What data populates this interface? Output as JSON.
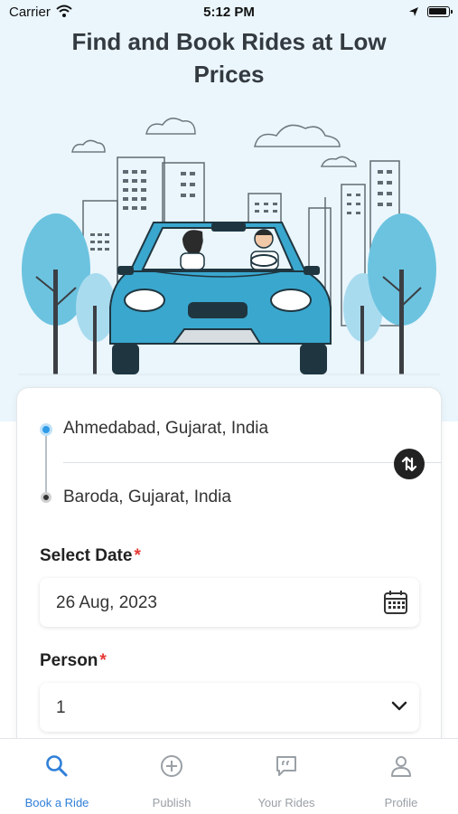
{
  "status_bar": {
    "carrier": "Carrier",
    "time": "5:12 PM"
  },
  "hero": {
    "title": "Find and Book Rides at Low Prices"
  },
  "route": {
    "from": "Ahmedabad, Gujarat, India",
    "to": "Baroda, Gujarat, India"
  },
  "date": {
    "label": "Select Date",
    "required_mark": "*",
    "value": "26 Aug, 2023"
  },
  "person": {
    "label": "Person",
    "required_mark": "*",
    "value": "1"
  },
  "tabs": [
    {
      "label": "Book a Ride",
      "icon": "search-icon",
      "active": true
    },
    {
      "label": "Publish",
      "icon": "plus-circle-icon",
      "active": false
    },
    {
      "label": "Your Rides",
      "icon": "chat-quote-icon",
      "active": false
    },
    {
      "label": "Profile",
      "icon": "user-icon",
      "active": false
    }
  ],
  "colors": {
    "accent": "#2f7fd8",
    "car": "#3aa7cf",
    "tree": "#6cc3df",
    "hero_bg": "#eaf6fc",
    "required": "#e53935"
  }
}
